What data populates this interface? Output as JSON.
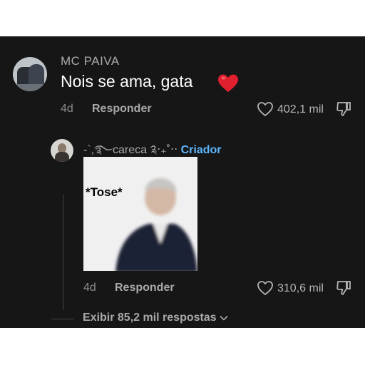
{
  "comment": {
    "username": "MC PAIVA",
    "text": "Nois se ama, gata",
    "emoji": "heart-emoji",
    "time": "4d",
    "reply_label": "Responder",
    "likes": "402,1 mil"
  },
  "reply": {
    "username": "-`,࿐careca ༉‧₊˚‧‧",
    "badge": "Criador",
    "image_caption": "*Tose*",
    "time": "4d",
    "reply_label": "Responder",
    "likes": "310,6 mil"
  },
  "more_replies_label": "Exibir 85,2 mil respostas",
  "colors": {
    "background": "#161616",
    "creator_badge": "#5db7ff",
    "heart": "#e0202e"
  }
}
